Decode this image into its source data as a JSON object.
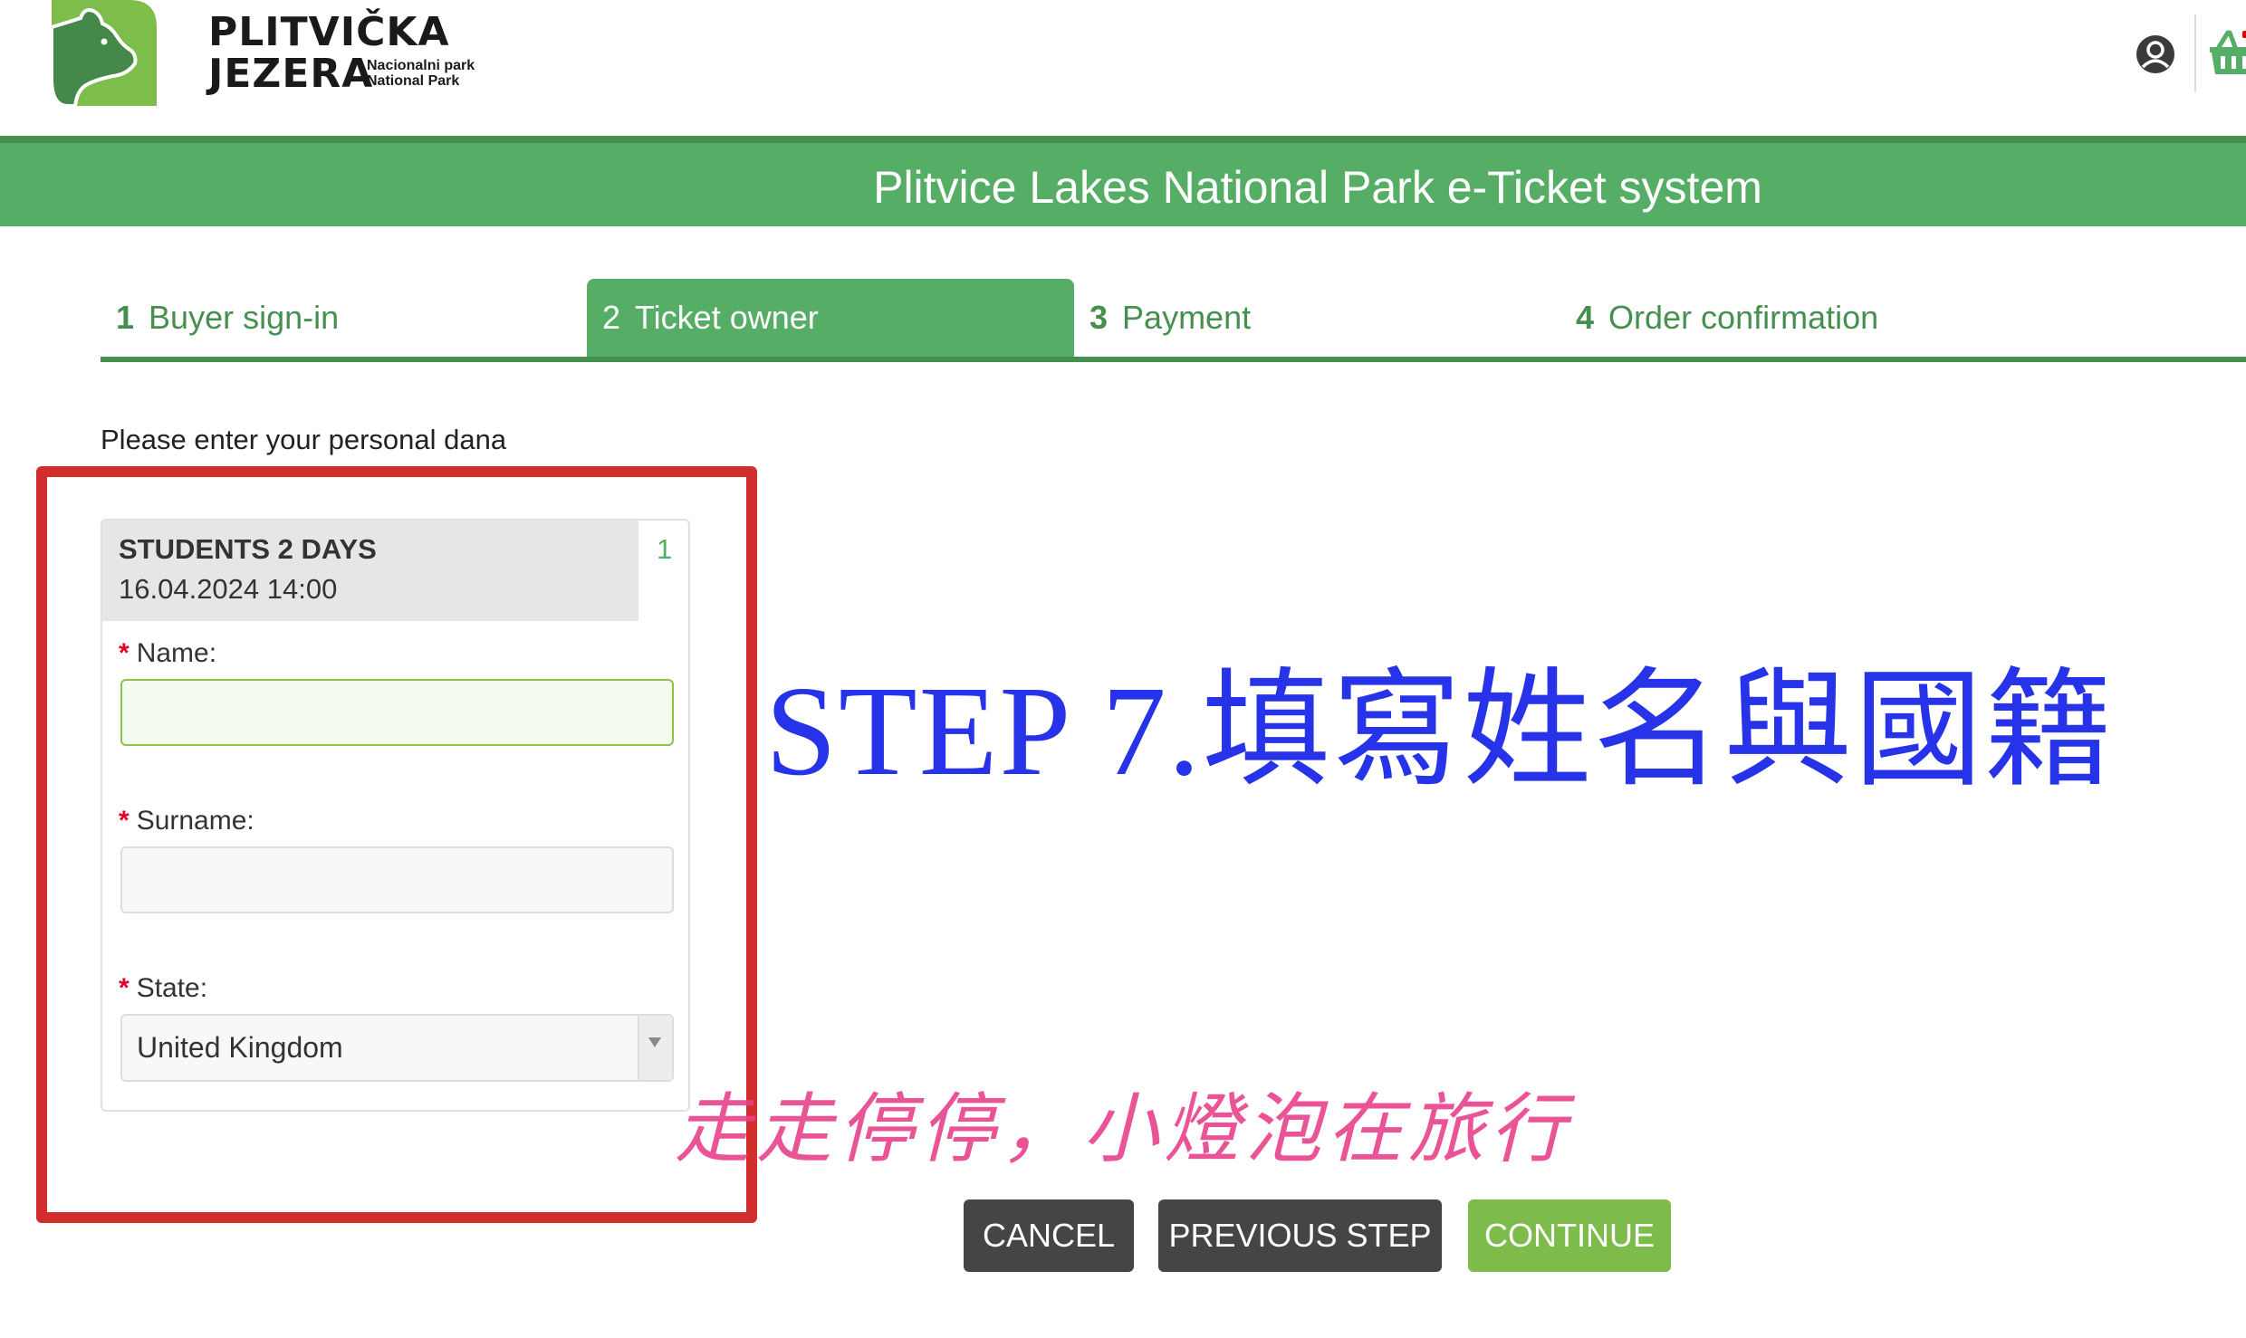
{
  "header": {
    "brand_line1": "PLITVIČKA",
    "brand_line2": "JEZERA",
    "brand_sub1": "Nacionalni park",
    "brand_sub2": "National Park",
    "icons": {
      "logo": "bear-logo-icon",
      "user": "user-account-icon",
      "cart": "shopping-basket-icon"
    }
  },
  "banner": {
    "title": "Plitvice Lakes National Park e-Ticket system"
  },
  "steps": [
    {
      "num": "1",
      "label": "Buyer sign-in",
      "active": false
    },
    {
      "num": "2",
      "label": "Ticket owner",
      "active": true
    },
    {
      "num": "3",
      "label": "Payment",
      "active": false
    },
    {
      "num": "4",
      "label": "Order confirmation",
      "active": false
    }
  ],
  "form": {
    "intro": "Please enter your personal dana",
    "ticket": {
      "name": "STUDENTS 2 DAYS",
      "datetime": "16.04.2024 14:00",
      "quantity": "1"
    },
    "fields": {
      "name": {
        "required_mark": "*",
        "label": "Name:",
        "value": "",
        "placeholder": ""
      },
      "surname": {
        "required_mark": "*",
        "label": "Surname:",
        "value": "",
        "placeholder": ""
      },
      "state": {
        "required_mark": "*",
        "label": "State:",
        "selected": "United Kingdom"
      }
    }
  },
  "buttons": {
    "cancel": "CANCEL",
    "previous": "PREVIOUS STEP",
    "continue": "CONTINUE"
  },
  "annotations": {
    "step_note": "STEP 7.填寫姓名與國籍",
    "watermark": "走走停停，小燈泡在旅行"
  },
  "colors": {
    "brand_green": "#56ae66",
    "dark_green": "#46904f",
    "continue_green": "#7dbb4a",
    "annotation_red": "#d32e2e",
    "annotation_blue": "#2733e8",
    "watermark_pink": "#e8418a"
  }
}
